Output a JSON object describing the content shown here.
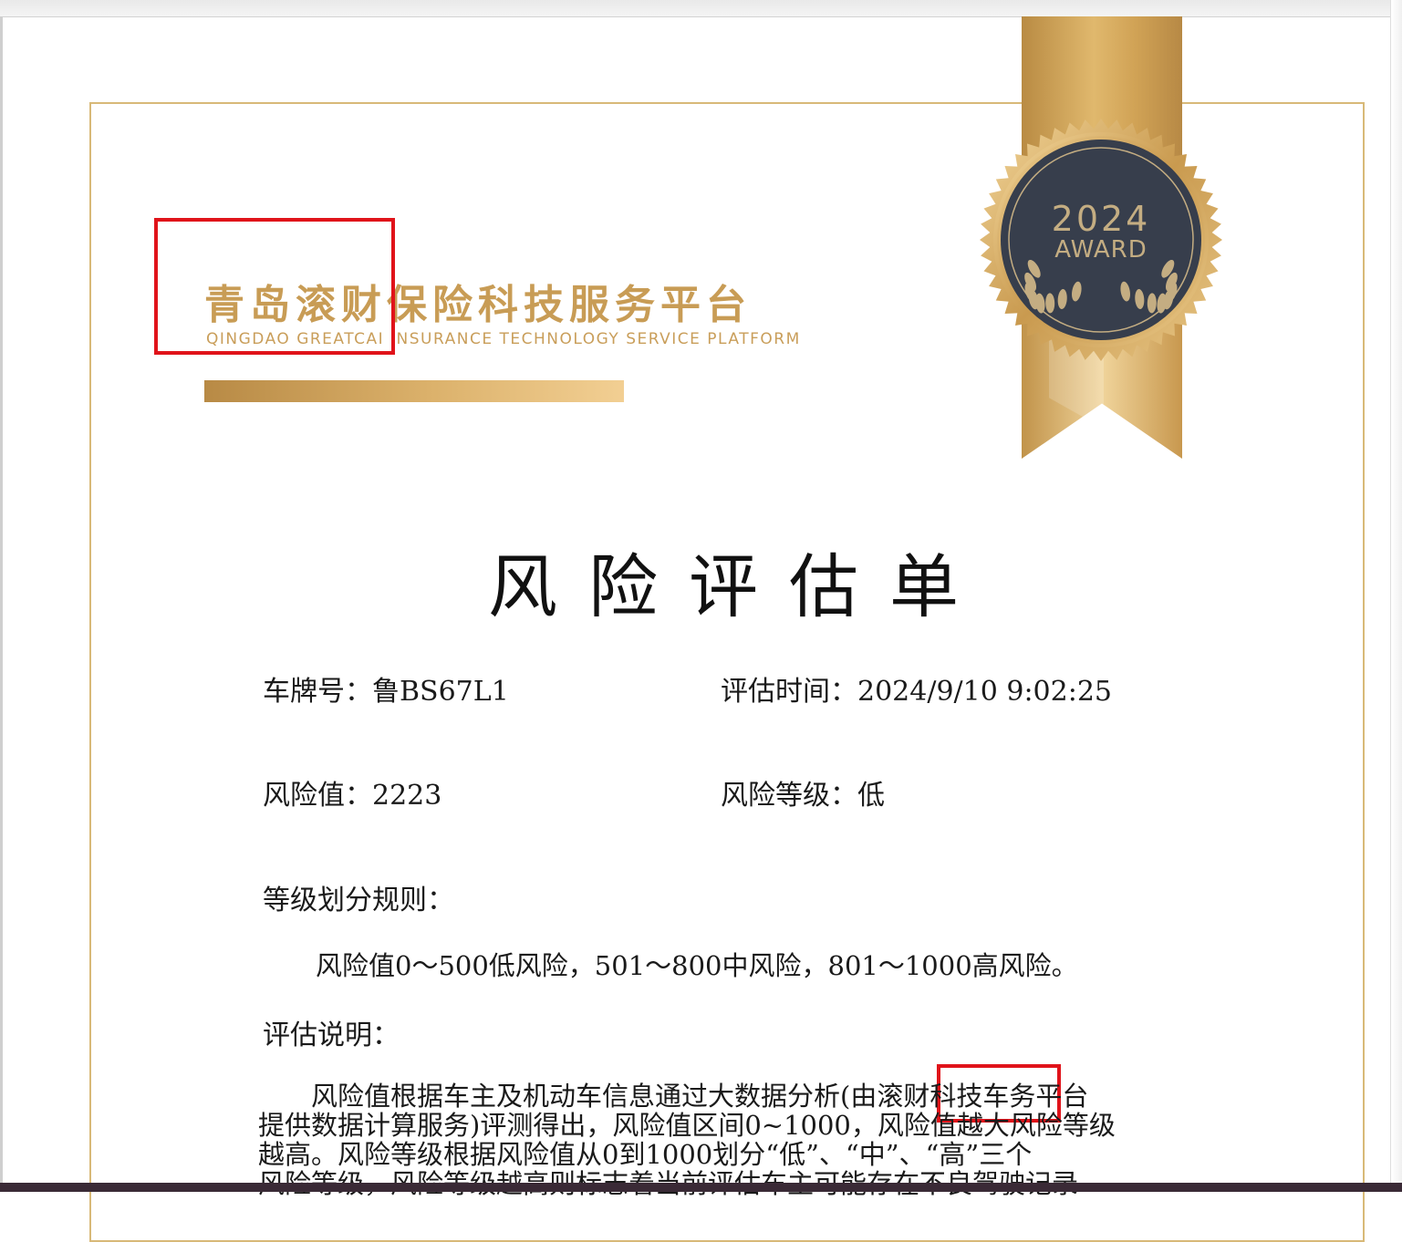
{
  "brand": {
    "title": "青岛滚财保险科技服务平台",
    "subtitle": "QINGDAO GREATCAI INSURANCE TECHNOLOGY SERVICE PLATFORM"
  },
  "seal": {
    "year": "2024",
    "award": "AWARD"
  },
  "document": {
    "title": "风险评估单",
    "plate_label": "车牌号：",
    "plate_value": "鲁BS67L1",
    "time_label": "评估时间：",
    "time_value": "2024/9/10 9:02:25",
    "risk_value_label": "风险值：",
    "risk_value": "2223",
    "risk_level_label": "风险等级：",
    "risk_level": "低",
    "rule_heading": "等级划分规则：",
    "rule_text": "风险值0～500低风险，501～800中风险，801～1000高风险。",
    "note_heading": "评估说明：",
    "note_lines": [
      "　　风险值根据车主及机动车信息通过大数据分析(由滚财科技车务平台",
      "提供数据计算服务)评测得出，风险值区间0~1000，风险值越大风险等级",
      "越高。风险等级根据风险值从0到1000划分“低”、“中”、“高”三个",
      "风险等级，风险等级越高则标志着当前评估车主可能存在不良驾驶记录"
    ]
  },
  "colors": {
    "gold": "#c89c55",
    "navy_seal": "#373e4c",
    "highlight_red": "#e0131a"
  }
}
